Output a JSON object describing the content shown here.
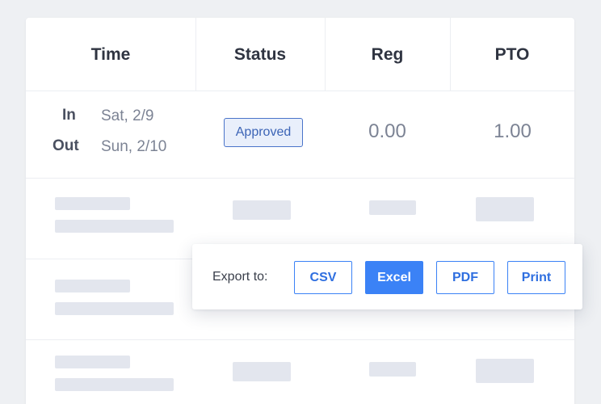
{
  "table": {
    "headers": [
      "Time",
      "Status",
      "Reg",
      "PTO"
    ],
    "rows": [
      {
        "in_label": "In",
        "in_date": "Sat, 2/9",
        "out_label": "Out",
        "out_date": "Sun, 2/10",
        "status": "Approved",
        "reg": "0.00",
        "pto": "1.00"
      }
    ]
  },
  "export": {
    "label": "Export to:",
    "buttons": [
      "CSV",
      "Excel",
      "PDF",
      "Print"
    ],
    "active": "Excel"
  },
  "colors": {
    "accent": "#3b82f6",
    "badge_border": "#4a74c9",
    "badge_bg": "#e9effb",
    "skeleton": "#e3e6ee",
    "background": "#eef0f3"
  }
}
